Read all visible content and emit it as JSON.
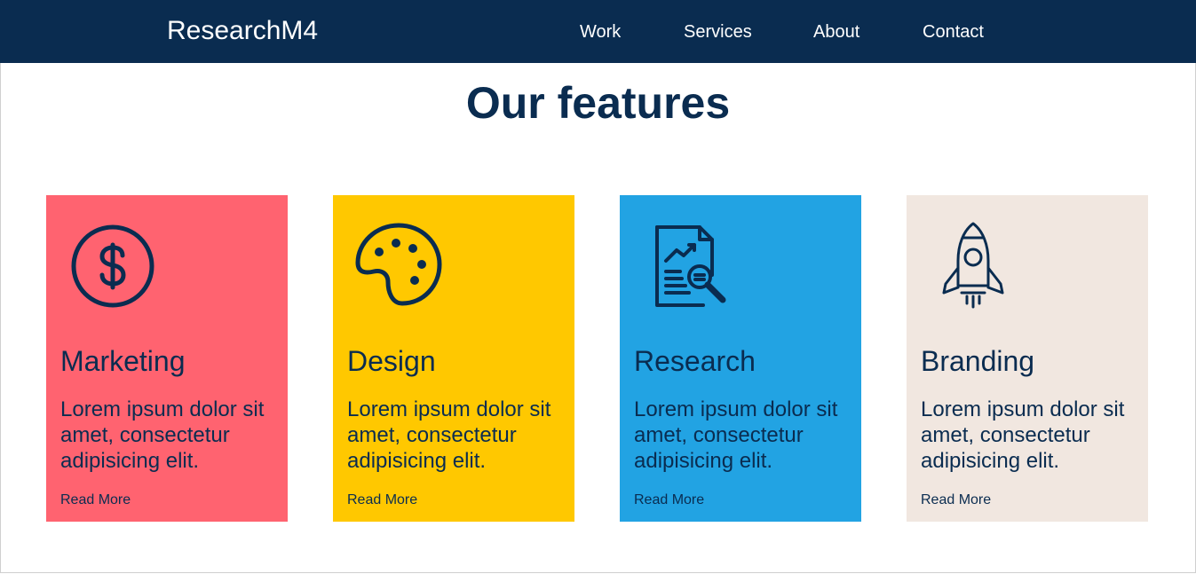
{
  "navbar": {
    "brand": "ResearchM4",
    "links": [
      "Work",
      "Services",
      "About",
      "Contact"
    ]
  },
  "page_title": "Our features",
  "cards": [
    {
      "title": "Marketing",
      "text": "Lorem ipsum dolor sit amet, consectetur adipisicing elit.",
      "link": "Read More",
      "icon": "dollar-circle-icon",
      "color": "#ff6370"
    },
    {
      "title": "Design",
      "text": "Lorem ipsum dolor sit amet, consectetur adipisicing elit.",
      "link": "Read More",
      "icon": "palette-icon",
      "color": "#ffc800"
    },
    {
      "title": "Research",
      "text": "Lorem ipsum dolor sit amet, consectetur adipisicing elit.",
      "link": "Read More",
      "icon": "report-magnifier-icon",
      "color": "#22a3e3"
    },
    {
      "title": "Branding",
      "text": "Lorem ipsum dolor sit amet, consectetur adipisicing elit.",
      "link": "Read More",
      "icon": "rocket-icon",
      "color": "#f1e7e0"
    }
  ],
  "colors": {
    "navbar_bg": "#0a2c50",
    "text_dark": "#0a2c50",
    "nav_text": "#ffffff"
  }
}
